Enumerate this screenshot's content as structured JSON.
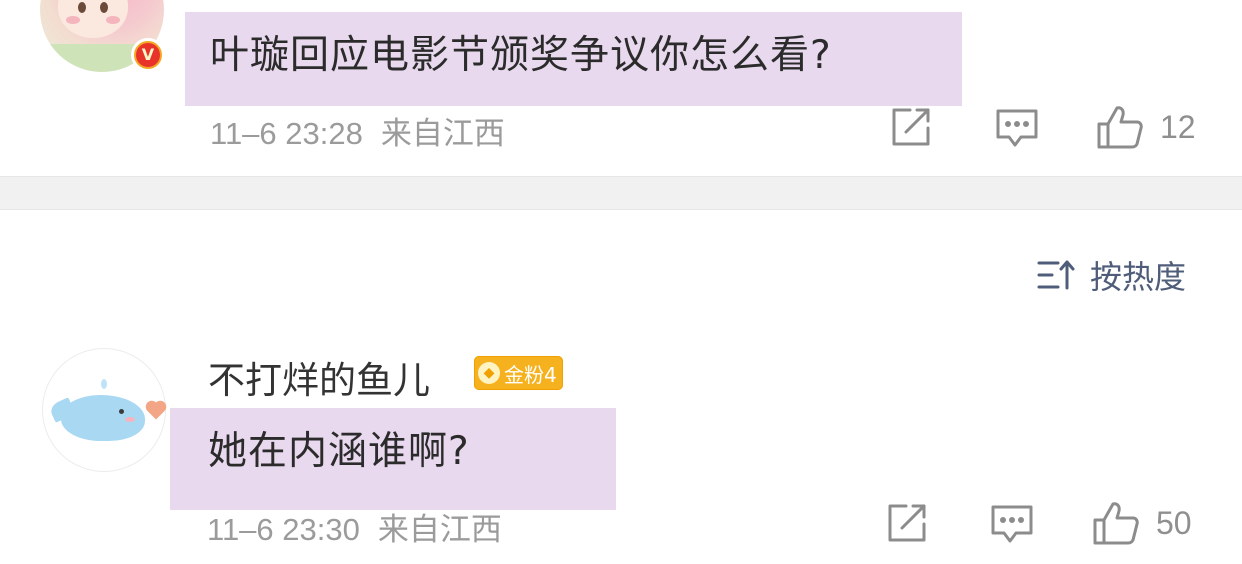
{
  "posts": [
    {
      "verified_badge": "V",
      "comment": "叶璇回应电影节颁奖争议你怎么看?",
      "date": "11–6 23:28",
      "location": "来自江西",
      "likes": "12"
    },
    {
      "username": "不打烊的鱼儿",
      "fan_badge": "金粉4",
      "comment": "她在内涵谁啊?",
      "date": "11–6 23:30",
      "location": "来自江西",
      "likes": "50"
    }
  ],
  "sort": {
    "label": "按热度"
  },
  "icons": {
    "share": "share-icon",
    "comment": "comment-icon",
    "like": "thumbs-up-icon",
    "sort": "sort-icon"
  },
  "colors": {
    "highlight": "#e8d9ee",
    "meta_text": "#9b9b9b",
    "sort_text": "#4f5d7a",
    "fan_badge": "#f6b21e",
    "verified": "#e8332a"
  }
}
